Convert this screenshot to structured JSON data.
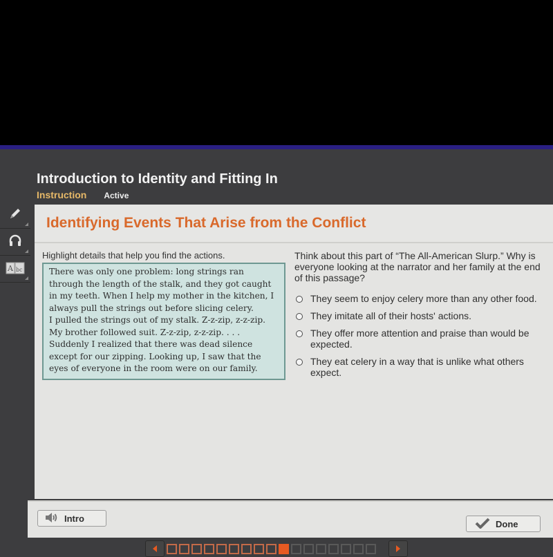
{
  "course": {
    "title": "Introduction to Identity and Fitting In",
    "breadcrumb_section": "Instruction",
    "breadcrumb_status": "Active"
  },
  "toolbar": {
    "tools": [
      {
        "icon": "pencil-icon",
        "label": "Highlighter"
      },
      {
        "icon": "headphones-icon",
        "label": "Audio"
      },
      {
        "icon": "dictionary-icon",
        "label": "Dictionary"
      }
    ]
  },
  "lesson": {
    "title": "Identifying Events That Arise from the Conflict",
    "instruction": "Highlight details that help you find the actions.",
    "passage": [
      "There was only one problem: long strings ran through the length of the stalk, and they got caught in my teeth. When I help my mother in the kitchen, I always pull the strings out before slicing celery.",
      "I pulled the strings out of my stalk. Z-z-zip, z-z-zip. My brother followed suit. Z-z-zip, z-z-zip. . . .",
      "Suddenly I realized that there was dead silence except for our zipping. Looking up, I saw that the eyes of everyone in the room were on our family."
    ],
    "question": "Think about this part of “The All-American Slurp.” Why is everyone looking at the narrator and her family at the end of this passage?",
    "options": [
      "They seem to enjoy celery more than any other food.",
      "They imitate all of their hosts' actions.",
      "They offer more attention and praise than would be expected.",
      "They eat celery in a way that is unlike what others expect."
    ]
  },
  "footer": {
    "intro_label": "Intro",
    "done_label": "Done"
  },
  "pager": {
    "total_steps": 17,
    "completed_steps": 9,
    "current_step": 10
  },
  "colors": {
    "accent_orange": "#d9692b",
    "pager_active": "#e65a22",
    "passage_bg": "#cfe3e0",
    "breadcrumb_gold": "#e7b968"
  }
}
